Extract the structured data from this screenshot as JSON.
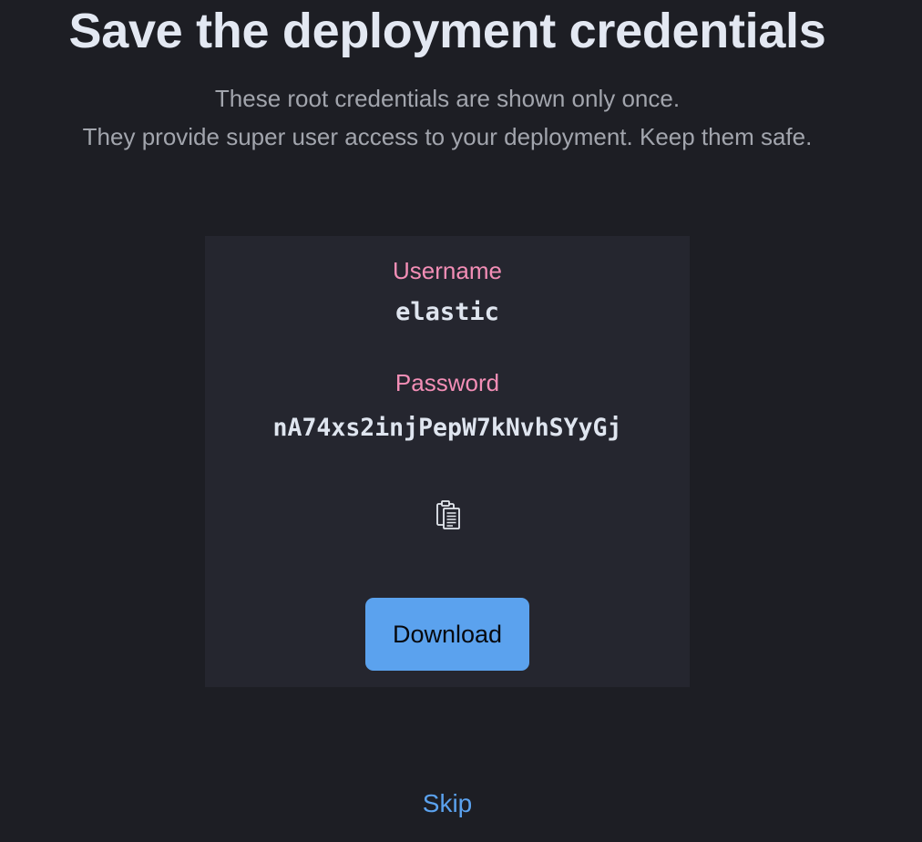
{
  "header": {
    "title": "Save the deployment credentials",
    "subtitle_line1": "These root credentials are shown only once.",
    "subtitle_line2": "They provide super user access to your deployment. Keep them safe."
  },
  "credentials": {
    "username_label": "Username",
    "username_value": "elastic",
    "password_label": "Password",
    "password_value": "nA74xs2injPepW7kNvhSYyGj",
    "copy_icon": "clipboard-icon"
  },
  "actions": {
    "download_label": "Download",
    "skip_label": "Skip"
  },
  "colors": {
    "background": "#1d1e24",
    "card": "#25262f",
    "label_pink": "#f38eb6",
    "accent_blue": "#5ba2ee",
    "title_text": "#e3e8f2",
    "muted_text": "#a2a5ad"
  }
}
